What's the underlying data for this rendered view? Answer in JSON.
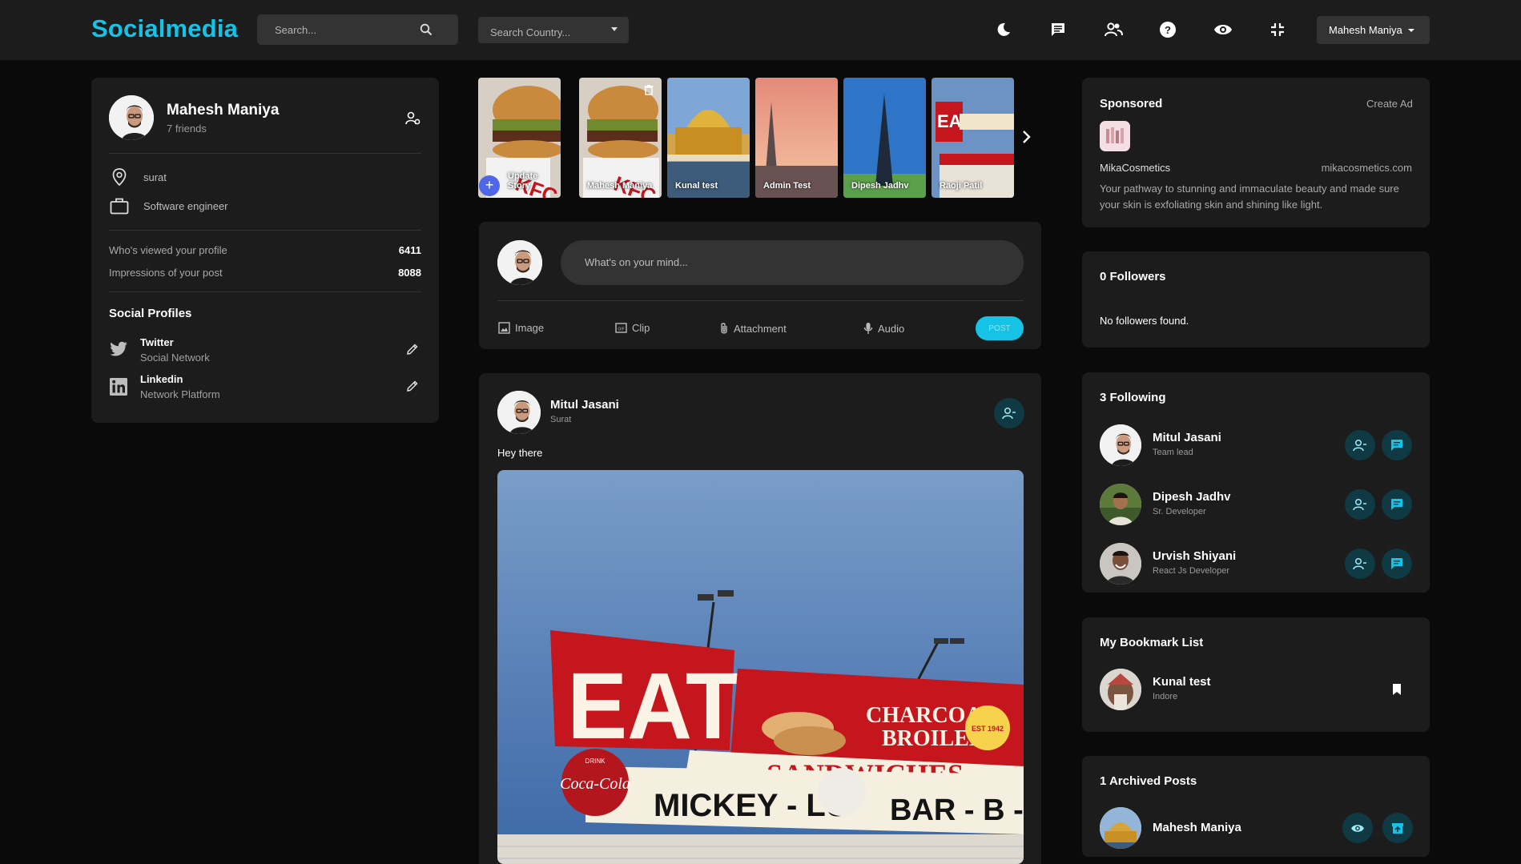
{
  "navbar": {
    "brand": "Socialmedia",
    "search_placeholder": "Search...",
    "country_placeholder": "Search Country...",
    "user_name": "Mahesh Maniya"
  },
  "profile": {
    "name": "Mahesh Maniya",
    "friends": "7 friends",
    "location": "surat",
    "job": "Software engineer",
    "stats": [
      {
        "label": "Who's viewed your profile",
        "value": "6411"
      },
      {
        "label": "Impressions of your post",
        "value": "8088"
      }
    ],
    "social_title": "Social Profiles",
    "social": [
      {
        "name": "Twitter",
        "sub": "Social Network",
        "icon": "twitter-icon"
      },
      {
        "name": "Linkedin",
        "sub": "Network Platform",
        "icon": "linkedin-icon"
      }
    ]
  },
  "stories": [
    {
      "label": "Update Story"
    },
    {
      "label": "Mahesh Maniya"
    },
    {
      "label": "Kunal test"
    },
    {
      "label": "Admin Test"
    },
    {
      "label": "Dipesh Jadhv"
    },
    {
      "label": "Raoji Patil"
    }
  ],
  "composer": {
    "placeholder": "What's on your mind...",
    "actions": [
      "Image",
      "Clip",
      "Attachment",
      "Audio"
    ],
    "post_label": "POST"
  },
  "post": {
    "author": "Mitul Jasani",
    "location": "Surat",
    "text": "Hey there",
    "sign_words": [
      "EAT",
      "CHARCOAL",
      "BROILED",
      "SANDWICHES",
      "MICKEY - LU",
      "BAR - B - Q",
      "Coca-Cola",
      "DRINK",
      "EST 1942"
    ]
  },
  "sponsored": {
    "title": "Sponsored",
    "create_ad": "Create Ad",
    "brand": "MikaCosmetics",
    "url": "mikacosmetics.com",
    "description": "Your pathway to stunning and immaculate beauty and made sure your skin is exfoliating skin and shining like light."
  },
  "followers": {
    "title": "0 Followers",
    "empty": "No followers found."
  },
  "following": {
    "title": "3 Following",
    "items": [
      {
        "name": "Mitul Jasani",
        "role": "Team lead"
      },
      {
        "name": "Dipesh Jadhv",
        "role": "Sr. Developer"
      },
      {
        "name": "Urvish Shiyani",
        "role": "React Js Developer"
      }
    ]
  },
  "bookmarks": {
    "title": "My Bookmark List",
    "items": [
      {
        "name": "Kunal test",
        "sub": "Indore"
      }
    ]
  },
  "archived": {
    "title": "1 Archived Posts",
    "items": [
      {
        "name": "Mahesh Maniya"
      }
    ]
  },
  "colors": {
    "accent": "#14c3e6",
    "card": "#1c1c1c",
    "background": "#0a0a0a"
  }
}
